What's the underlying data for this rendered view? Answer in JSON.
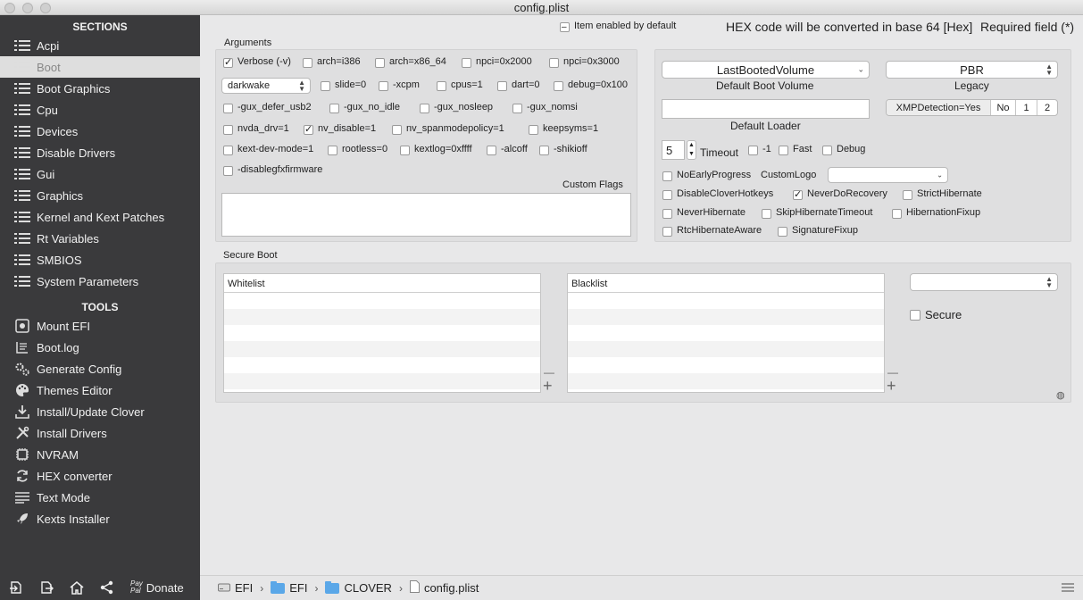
{
  "window": {
    "title": "config.plist"
  },
  "sidebar": {
    "sections_header": "SECTIONS",
    "sections": [
      {
        "label": "Acpi",
        "active": false
      },
      {
        "label": "Boot",
        "active": true
      },
      {
        "label": "Boot Graphics",
        "active": false
      },
      {
        "label": "Cpu",
        "active": false
      },
      {
        "label": "Devices",
        "active": false
      },
      {
        "label": "Disable Drivers",
        "active": false
      },
      {
        "label": "Gui",
        "active": false
      },
      {
        "label": "Graphics",
        "active": false
      },
      {
        "label": "Kernel and Kext Patches",
        "active": false
      },
      {
        "label": "Rt Variables",
        "active": false
      },
      {
        "label": "SMBIOS",
        "active": false
      },
      {
        "label": "System Parameters",
        "active": false
      }
    ],
    "tools_header": "TOOLS",
    "tools": [
      {
        "label": "Mount EFI",
        "icon": "disk-icon"
      },
      {
        "label": "Boot.log",
        "icon": "log-icon"
      },
      {
        "label": "Generate Config",
        "icon": "gears-icon"
      },
      {
        "label": "Themes Editor",
        "icon": "palette-icon"
      },
      {
        "label": "Install/Update Clover",
        "icon": "download-icon"
      },
      {
        "label": "Install Drivers",
        "icon": "tools-icon"
      },
      {
        "label": "NVRAM",
        "icon": "chip-icon"
      },
      {
        "label": "HEX converter",
        "icon": "refresh-icon"
      },
      {
        "label": "Text Mode",
        "icon": "text-lines-icon"
      },
      {
        "label": "Kexts Installer",
        "icon": "rocket-icon"
      }
    ],
    "footer": {
      "paypal_top": "Pay",
      "paypal_bottom": "Pal",
      "donate": "Donate"
    }
  },
  "header": {
    "item_enabled_legend": "Item enabled by default",
    "hex_note": "HEX code will be converted in base 64 [Hex]",
    "required_note": "Required field (*)"
  },
  "arguments": {
    "title": "Arguments",
    "row1": [
      {
        "label": "Verbose (-v)",
        "checked": true
      },
      {
        "label": "arch=i386",
        "checked": false
      },
      {
        "label": "arch=x86_64",
        "checked": false
      },
      {
        "label": "npci=0x2000",
        "checked": false
      },
      {
        "label": "npci=0x3000",
        "checked": false
      }
    ],
    "darkwake_value": "darkwake",
    "row2": [
      {
        "label": "slide=0",
        "checked": false
      },
      {
        "label": "-xcpm",
        "checked": false
      },
      {
        "label": "cpus=1",
        "checked": false
      },
      {
        "label": "dart=0",
        "checked": false
      },
      {
        "label": "debug=0x100",
        "checked": false
      }
    ],
    "row3": [
      {
        "label": "-gux_defer_usb2",
        "checked": false
      },
      {
        "label": "-gux_no_idle",
        "checked": false
      },
      {
        "label": "-gux_nosleep",
        "checked": false
      },
      {
        "label": "-gux_nomsi",
        "checked": false
      }
    ],
    "row4": [
      {
        "label": "nvda_drv=1",
        "checked": false
      },
      {
        "label": "nv_disable=1",
        "checked": true
      },
      {
        "label": "nv_spanmodepolicy=1",
        "checked": false
      },
      {
        "label": "keepsyms=1",
        "checked": false
      }
    ],
    "row5": [
      {
        "label": "kext-dev-mode=1",
        "checked": false
      },
      {
        "label": "rootless=0",
        "checked": false
      },
      {
        "label": "kextlog=0xffff",
        "checked": false
      },
      {
        "label": "-alcoff",
        "checked": false
      },
      {
        "label": "-shikioff",
        "checked": false
      }
    ],
    "row6": [
      {
        "label": "-disablegfxfirmware",
        "checked": false
      }
    ],
    "custom_flags_label": "Custom Flags",
    "custom_flags_value": ""
  },
  "boot": {
    "default_volume_value": "LastBootedVolume",
    "default_volume_label": "Default Boot Volume",
    "legacy_value": "PBR",
    "legacy_label": "Legacy",
    "default_loader_value": "",
    "default_loader_label": "Default Loader",
    "xmp": [
      "XMPDetection=Yes",
      "No",
      "1",
      "2"
    ],
    "timeout_value": "5",
    "timeout_label": "Timeout",
    "timeout_flags": [
      {
        "label": "-1",
        "checked": false
      },
      {
        "label": "Fast",
        "checked": false
      },
      {
        "label": "Debug",
        "checked": false
      }
    ],
    "no_early_progress": {
      "label": "NoEarlyProgress",
      "checked": false
    },
    "custom_logo_label": "CustomLogo",
    "custom_logo_value": "",
    "flags_row1": [
      {
        "label": "DisableCloverHotkeys",
        "checked": false
      },
      {
        "label": "NeverDoRecovery",
        "checked": true
      },
      {
        "label": "StrictHibernate",
        "checked": false
      }
    ],
    "flags_row2": [
      {
        "label": "NeverHibernate",
        "checked": false
      },
      {
        "label": "SkipHibernateTimeout",
        "checked": false
      },
      {
        "label": "HibernationFixup",
        "checked": false
      }
    ],
    "flags_row3": [
      {
        "label": "RtcHibernateAware",
        "checked": false
      },
      {
        "label": "SignatureFixup",
        "checked": false
      }
    ]
  },
  "secure_boot": {
    "title": "Secure Boot",
    "whitelist_header": "Whitelist",
    "blacklist_header": "Blacklist",
    "policy_value": "",
    "secure_label": "Secure",
    "secure_checked": false,
    "plus": "+",
    "minus": "—"
  },
  "bottombar": {
    "path": [
      {
        "label": "EFI",
        "icon": "drive-icon"
      },
      {
        "label": "EFI",
        "icon": "folder-icon"
      },
      {
        "label": "CLOVER",
        "icon": "folder-icon"
      },
      {
        "label": "config.plist",
        "icon": "document-icon"
      }
    ]
  }
}
